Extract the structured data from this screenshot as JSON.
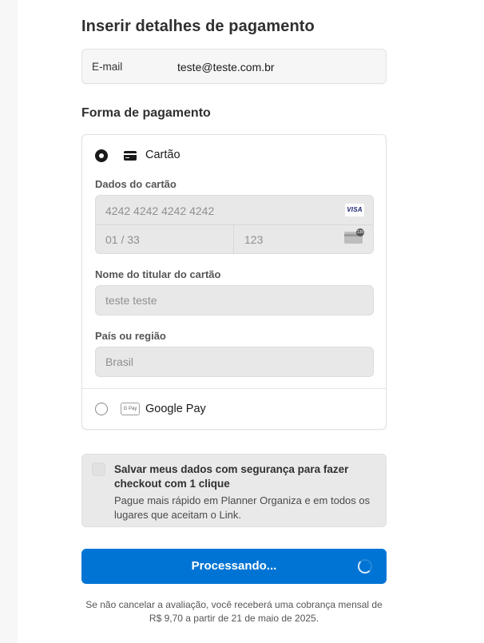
{
  "page": {
    "title": "Inserir detalhes de pagamento"
  },
  "email": {
    "label": "E-mail",
    "value": "teste@teste.com.br"
  },
  "payment": {
    "section_title": "Forma de pagamento",
    "card_option": {
      "label": "Cartão",
      "selected": true
    },
    "card_details": {
      "label": "Dados do cartão",
      "number_placeholder": "4242 4242 4242 4242",
      "brand": "VISA",
      "expiry_placeholder": "01 / 33",
      "cvc_placeholder": "123",
      "cvc_badge": "135"
    },
    "cardholder": {
      "label": "Nome do titular do cartão",
      "value": "teste teste"
    },
    "country": {
      "label": "País ou região",
      "value": "Brasil"
    },
    "gpay_option": {
      "label": "Google Pay",
      "icon_text": "G Pay",
      "selected": false
    }
  },
  "link": {
    "title": "Salvar meus dados com segurança para fazer checkout com 1 clique",
    "description": "Pague mais rápido em Planner Organiza e em todos os lugares que aceitam o Link.",
    "checked": false
  },
  "submit": {
    "label": "Processando...",
    "color": "#0074d4"
  },
  "footer": {
    "note": "Se não cancelar a avaliação, você receberá uma cobrança mensal de R$ 9,70 a partir de 21 de maio de 2025."
  }
}
